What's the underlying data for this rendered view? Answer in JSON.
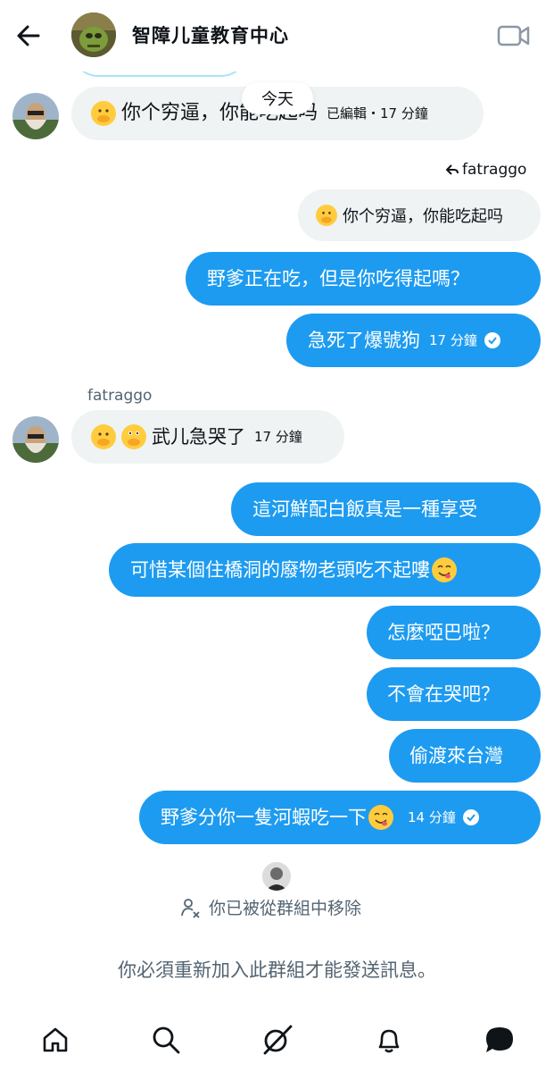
{
  "header": {
    "title": "智障儿童教育中心"
  },
  "date_separator": "今天",
  "messages": [
    {
      "text": "你个穷逼，你能吃起吗",
      "meta": "已編輯・17 分鐘"
    },
    {
      "text": "野爹正在吃，但是你吃得起嗎？"
    },
    {
      "text": "急死了爆號狗",
      "time": "17 分鐘"
    },
    {
      "text": "武儿急哭了",
      "time": "17 分鐘"
    },
    {
      "text": "這河鮮配白飯真是一種享受"
    },
    {
      "text": "可惜某個住橋洞的廢物老頭吃不起嘍"
    },
    {
      "text": "怎麼啞巴啦？"
    },
    {
      "text": "不會在哭吧？"
    },
    {
      "text": "偷渡來台灣"
    },
    {
      "text": "野爹分你一隻河蝦吃一下",
      "time": "14 分鐘"
    }
  ],
  "reply": {
    "label": "fatraggo",
    "quoted_text": "你个穷逼，你能吃起吗"
  },
  "sender_name": "fatraggo",
  "system": {
    "removed_text": "你已被從群組中移除",
    "rejoin_text": "你必須重新加入此群組才能發送訊息。"
  },
  "colors": {
    "accent": "#1d9bf0",
    "incoming_bubble": "#eff3f4",
    "muted_text": "#536471"
  },
  "icons": {
    "back": "arrow-left",
    "video": "video-camera",
    "nav": [
      "home",
      "search",
      "grok",
      "notifications-bell",
      "messages"
    ]
  }
}
